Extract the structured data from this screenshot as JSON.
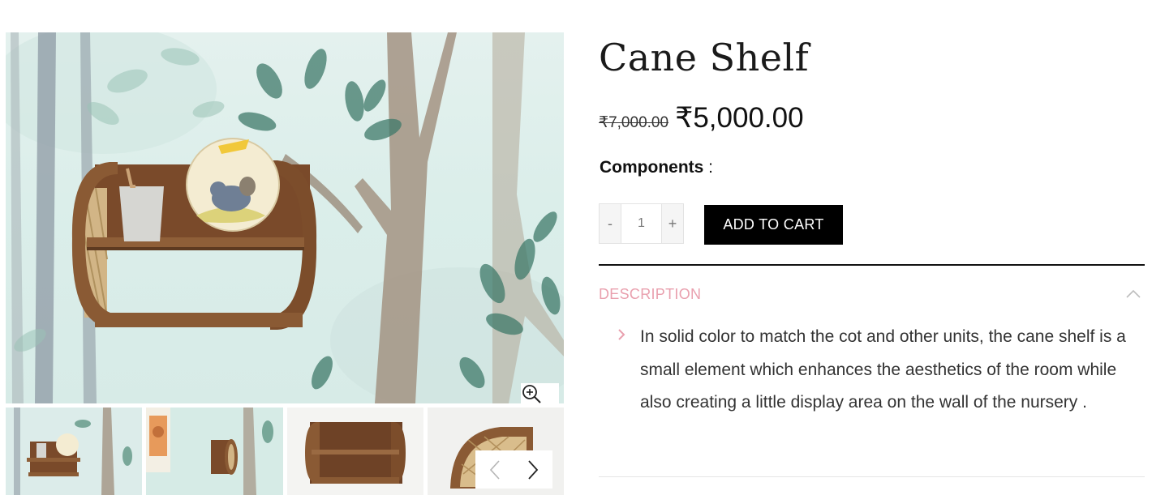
{
  "product": {
    "title": "Cane Shelf",
    "old_price": "₹7,000.00",
    "new_price": "₹5,000.00",
    "components_label": "Components",
    "components_separator": " :"
  },
  "quantity": {
    "minus_label": "-",
    "value": "1",
    "plus_label": "+"
  },
  "add_to_cart_label": "ADD TO CART",
  "description": {
    "heading": "DESCRIPTION",
    "expanded": true,
    "text": "In solid color to match the cot and other units, the cane shelf is a small element which enhances the aesthetics of the room while also creating a little display area on the wall of the nursery ."
  },
  "gallery": {
    "main_image": "cane-shelf-with-elephant-plate",
    "thumbnails": [
      "shelf-on-tree-wallpaper",
      "shelf-with-giraffe-frame",
      "shelf-front-view",
      "shelf-cane-side-view"
    ],
    "zoom_icon": "zoom-in-icon",
    "prev_icon": "chevron-left-icon",
    "next_icon": "chevron-right-icon"
  },
  "colors": {
    "accent": "#e9a0ae",
    "button": "#000000",
    "wood": "#8a5a34"
  }
}
